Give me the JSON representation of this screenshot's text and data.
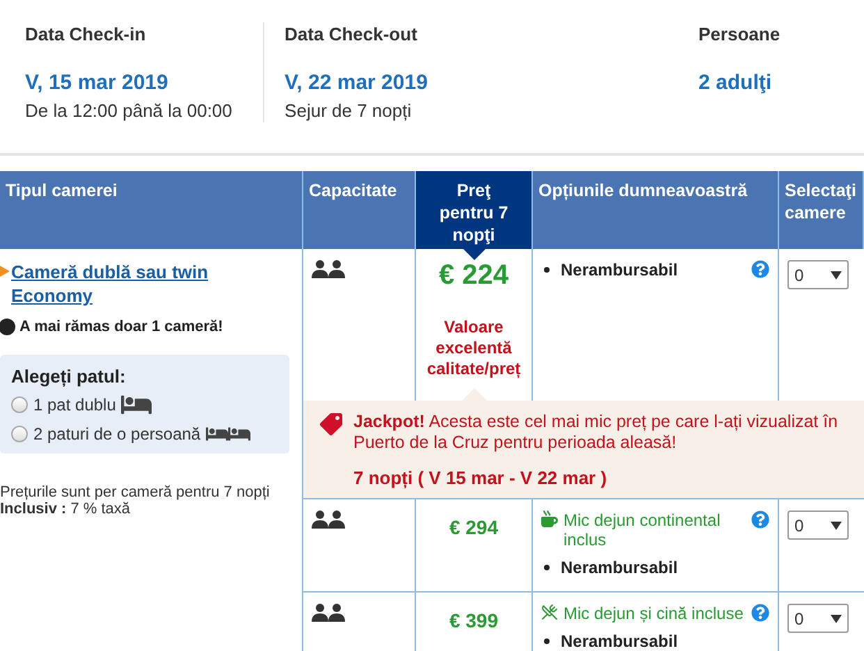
{
  "stay": [
    {
      "label": "Data Check-in",
      "value": "V, 15 mar 2019",
      "note": "De la 12:00 până la 00:00"
    },
    {
      "label": "Data Check-out",
      "value": "V, 22 mar 2019",
      "note": "Sejur de 7 nopți"
    },
    {
      "label": "Persoane",
      "value": "2 adulţi"
    }
  ],
  "table": {
    "columns": [
      {
        "label": "Tipul camerei",
        "selected": false
      },
      {
        "label": "Capacitate",
        "selected": false
      },
      {
        "label": "Preţ pentru 7 nopţi",
        "selected": true
      },
      {
        "label": "Opțiunile dumneavoastră",
        "selected": false
      },
      {
        "label": "Selectaţi camere",
        "selected": false
      }
    ],
    "room": {
      "name": " Cameră dublă sau twin Economy",
      "scarcity": "A mai rămas doar 1 cameră!",
      "bed_choice": {
        "title": "Alegeți patul:",
        "options": [
          {
            "label": "1 pat dublu",
            "kind": "double",
            "selected": false
          },
          {
            "label": "2 paturi de o persoană",
            "kind": "twin",
            "selected": false
          }
        ]
      },
      "price_note": "Prețurile sunt per cameră pentru 7 nopți",
      "tax": {
        "label": "Inclusiv :",
        "value": " 7 % taxă"
      }
    },
    "offers": [
      {
        "price": "€ 224",
        "highlight": "Valoare excelentă calitate/preț",
        "quantity": "0",
        "options": [
          {
            "kind": "policy",
            "text": "Nerambursabil"
          }
        ]
      },
      {
        "price": "€ 294",
        "quantity": "0",
        "options": [
          {
            "kind": "breakfast",
            "text": "Mic dejun continental inclus"
          },
          {
            "kind": "policy",
            "text": "Nerambursabil"
          }
        ]
      },
      {
        "price": "€ 399",
        "quantity": "0",
        "options": [
          {
            "kind": "half_board",
            "text": "Mic dejun și cină incluse"
          },
          {
            "kind": "policy",
            "text": "Nerambursabil"
          }
        ]
      }
    ],
    "jackpot": {
      "title": "Jackpot!",
      "text": " Acesta este cel mai mic preț pe care l-ați vizualizat în Puerto de la Cruz pentru perioada aleasă!",
      "dates": "7 nopți ( V 15 mar - V 22 mar )"
    }
  }
}
